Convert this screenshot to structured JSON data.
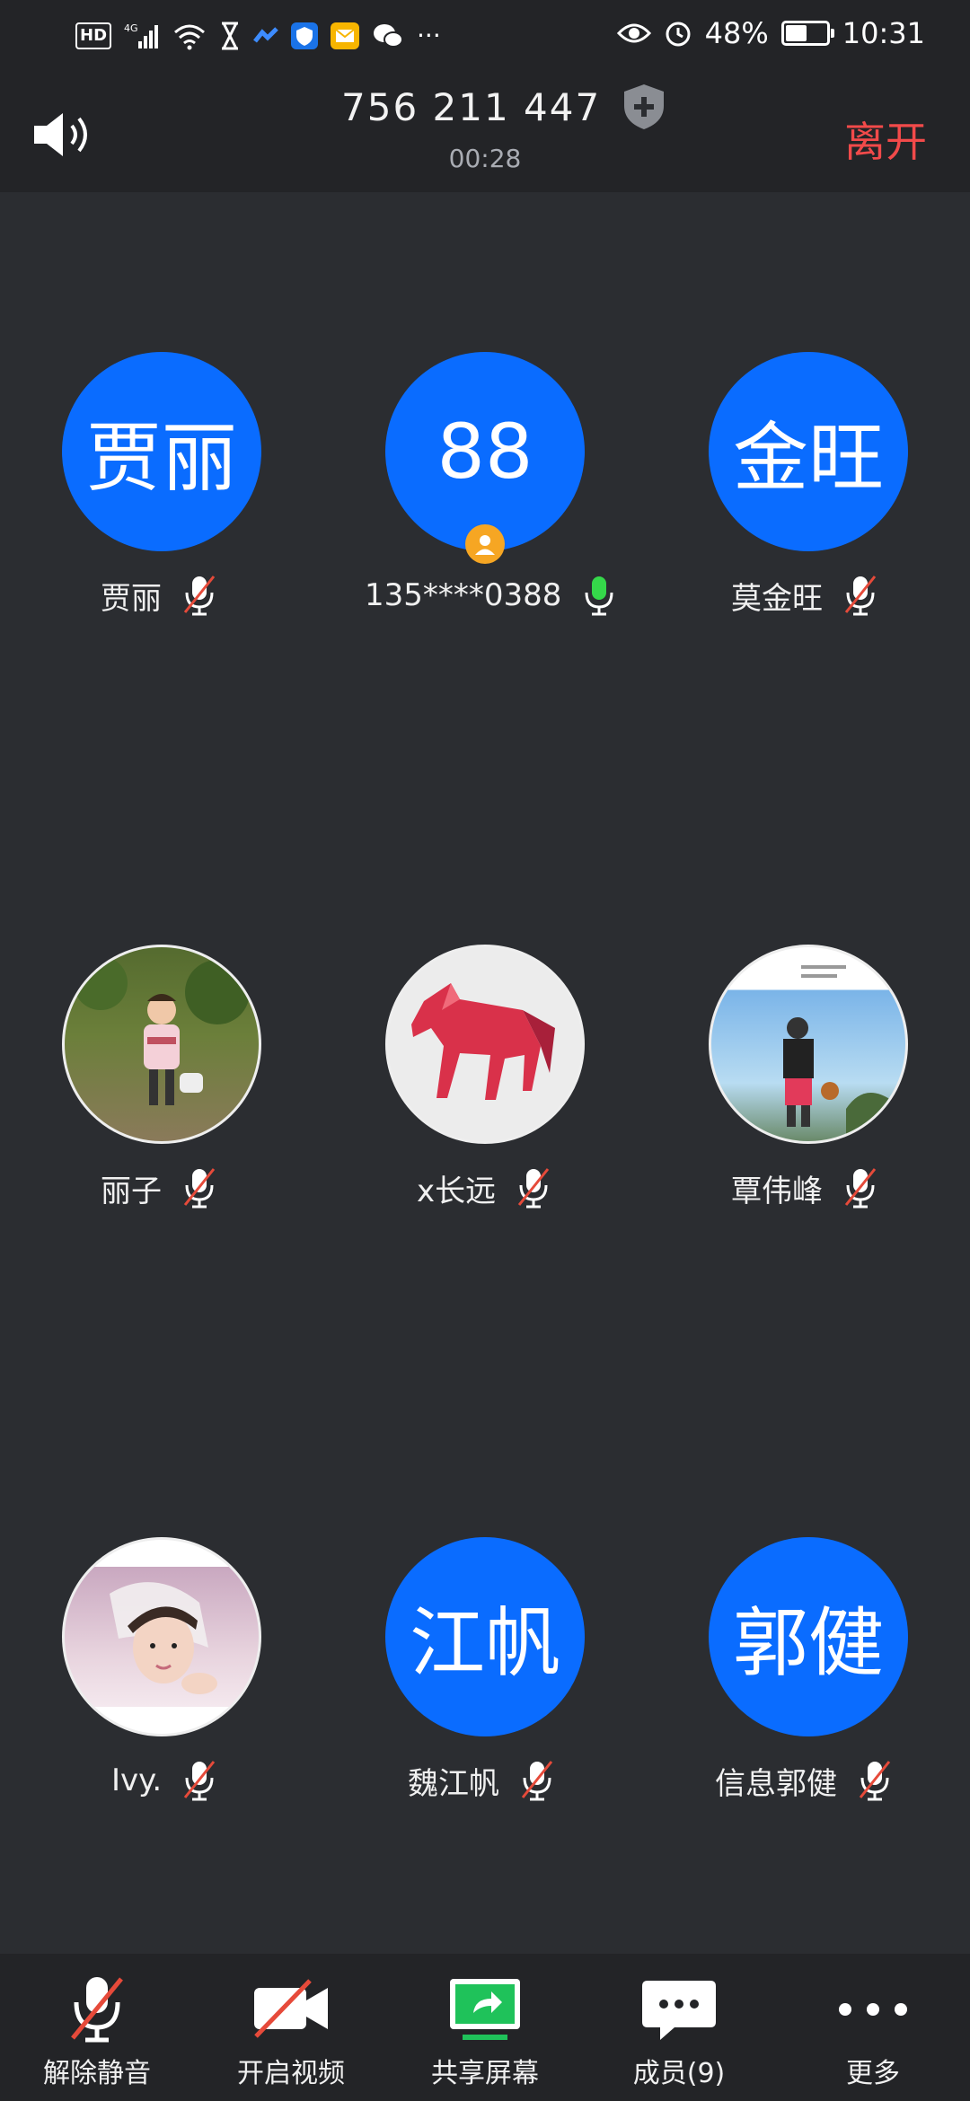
{
  "status_bar": {
    "left_icons": [
      "hd-icon",
      "4g-signal-icon",
      "wifi-icon",
      "hourglass-icon",
      "app-icon",
      "shield-app-icon",
      "mail-app-icon",
      "wechat-icon",
      "more-dots-icon"
    ],
    "battery_percent": "48%",
    "time": "10:31",
    "hd_label": "HD",
    "more_label": "···"
  },
  "header": {
    "meeting_id": "756 211 447",
    "elapsed": "00:28",
    "leave_label": "离开"
  },
  "participants": [
    {
      "avatar_text": "贾丽",
      "name": "贾丽",
      "mic": "muted"
    },
    {
      "avatar_text": "88",
      "name": "135****0388",
      "mic": "active",
      "host": true
    },
    {
      "avatar_text": "金旺",
      "name": "莫金旺",
      "mic": "muted"
    },
    {
      "avatar_photo": "girl-with-basket",
      "name": "丽子",
      "mic": "muted"
    },
    {
      "avatar_photo": "red-horse",
      "name": "x长远",
      "mic": "muted"
    },
    {
      "avatar_photo": "basketball-player",
      "name": "覃伟峰",
      "mic": "muted"
    },
    {
      "avatar_photo": "child-portrait",
      "name": "Ivy.",
      "mic": "muted"
    },
    {
      "avatar_text": "江帆",
      "name": "魏江帆",
      "mic": "muted"
    },
    {
      "avatar_text": "郭健",
      "name": "信息郭健",
      "mic": "muted"
    }
  ],
  "toolbar": {
    "unmute_label": "解除静音",
    "video_label": "开启视频",
    "share_label": "共享屏幕",
    "members_label": "成员(9)",
    "more_label": "更多"
  },
  "colors": {
    "accent_blue": "#0a6cff",
    "leave_red": "#f24a4a",
    "mic_active_green": "#35d84a",
    "share_green": "#1fc25a",
    "muted_slash_red": "#e64a3a",
    "host_badge_orange": "#f6a623"
  }
}
